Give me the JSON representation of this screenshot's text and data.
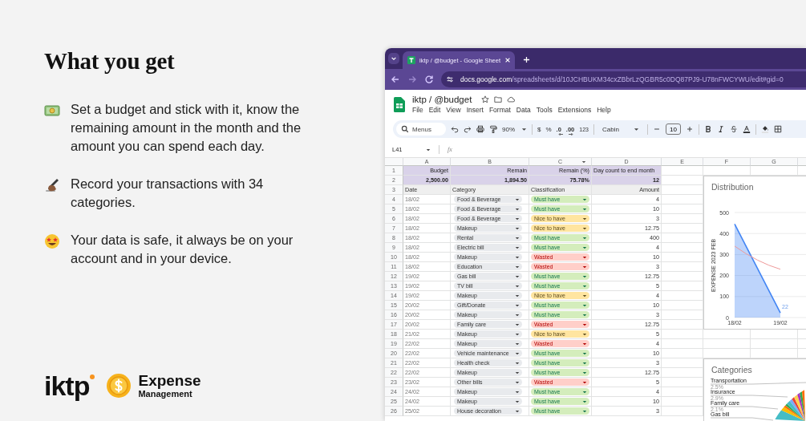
{
  "intro": {
    "title": "What you get",
    "points": [
      {
        "kind": "money",
        "text": "Set a budget and stick with it, know the remaining amount in the month and the amount you can spend each day."
      },
      {
        "kind": "writing",
        "text": "Record your transactions with 34 categories."
      },
      {
        "kind": "star_eyes",
        "text": "Your data is safe, it always be on your account and in your device."
      }
    ]
  },
  "brand": {
    "logo": "iktp",
    "product_name": "Expense",
    "product_subtitle": "Management"
  },
  "browser": {
    "tab_title": "iktp / @budget - Google Sheet",
    "url_host": "docs.google.com",
    "url_path": "/spreadsheets/d/10JCHBUKM34cxZBbrLzQGBR5c0DQ87PJ9-U78nFWCYWU/edit#gid=0"
  },
  "sheet": {
    "title": "iktp / @budget",
    "menu": [
      "File",
      "Edit",
      "View",
      "Insert",
      "Format",
      "Data",
      "Tools",
      "Extensions",
      "Help"
    ],
    "toolbar": {
      "search_placeholder": "Menus",
      "zoom": "90%",
      "currency": "$",
      "percent": "%",
      "decrease_decimals": ".0",
      "increase_decimals": ".00",
      "number_format": "123",
      "font": "Cabin",
      "font_size": "10"
    },
    "cell_ref": "L41",
    "formula_label": "fx",
    "columns": [
      "A",
      "B",
      "C",
      "D",
      "E",
      "F",
      "G"
    ],
    "row_numbers": [
      "1",
      "2",
      "3",
      "4",
      "5",
      "6",
      "7",
      "8",
      "9",
      "10",
      "11",
      "12",
      "13",
      "14",
      "15",
      "16",
      "17",
      "18",
      "19",
      "20",
      "21",
      "22",
      "23",
      "24",
      "25",
      "26"
    ],
    "summary": [
      {
        "label": "Budget",
        "value": "2,500.00"
      },
      {
        "label": "Remain",
        "value": "1,894.50"
      },
      {
        "label": "Remain (%)",
        "value": "75.78%"
      },
      {
        "label": "Day count to end month",
        "value": "12"
      }
    ],
    "header": [
      "Date",
      "Category",
      "Classification",
      "Amount"
    ],
    "rows": [
      {
        "date": "18/02",
        "category": "Food & Beverage",
        "classification": "Must have",
        "kind": "must_have",
        "amount": "4"
      },
      {
        "date": "18/02",
        "category": "Food & Beverage",
        "classification": "Must have",
        "kind": "must_have",
        "amount": "10"
      },
      {
        "date": "18/02",
        "category": "Food & Beverage",
        "classification": "Nice to have",
        "kind": "nice_to_have",
        "amount": "3"
      },
      {
        "date": "18/02",
        "category": "Makeup",
        "classification": "Nice to have",
        "kind": "nice_to_have",
        "amount": "12.75"
      },
      {
        "date": "18/02",
        "category": "Rental",
        "classification": "Must have",
        "kind": "must_have",
        "amount": "400"
      },
      {
        "date": "18/02",
        "category": "Electric bill",
        "classification": "Must have",
        "kind": "must_have",
        "amount": "4"
      },
      {
        "date": "18/02",
        "category": "Makeup",
        "classification": "Wasted",
        "kind": "wasted",
        "amount": "10"
      },
      {
        "date": "18/02",
        "category": "Education",
        "classification": "Wasted",
        "kind": "wasted",
        "amount": "3"
      },
      {
        "date": "19/02",
        "category": "Gas bill",
        "classification": "Must have",
        "kind": "must_have",
        "amount": "12.75"
      },
      {
        "date": "19/02",
        "category": "TV bill",
        "classification": "Must have",
        "kind": "must_have",
        "amount": "5"
      },
      {
        "date": "19/02",
        "category": "Makeup",
        "classification": "Nice to have",
        "kind": "nice_to_have",
        "amount": "4"
      },
      {
        "date": "20/02",
        "category": "Gift/Donate",
        "classification": "Must have",
        "kind": "must_have",
        "amount": "10"
      },
      {
        "date": "20/02",
        "category": "Makeup",
        "classification": "Must have",
        "kind": "must_have",
        "amount": "3"
      },
      {
        "date": "20/02",
        "category": "Family care",
        "classification": "Wasted",
        "kind": "wasted",
        "amount": "12.75"
      },
      {
        "date": "21/02",
        "category": "Makeup",
        "classification": "Nice to have",
        "kind": "nice_to_have",
        "amount": "5"
      },
      {
        "date": "22/02",
        "category": "Makeup",
        "classification": "Wasted",
        "kind": "wasted",
        "amount": "4"
      },
      {
        "date": "22/02",
        "category": "Vehicle maintenance",
        "classification": "Must have",
        "kind": "must_have",
        "amount": "10"
      },
      {
        "date": "22/02",
        "category": "Health check",
        "classification": "Must have",
        "kind": "must_have",
        "amount": "3"
      },
      {
        "date": "22/02",
        "category": "Makeup",
        "classification": "Must have",
        "kind": "must_have",
        "amount": "12.75"
      },
      {
        "date": "23/02",
        "category": "Other bills",
        "classification": "Wasted",
        "kind": "wasted",
        "amount": "5"
      },
      {
        "date": "24/02",
        "category": "Makeup",
        "classification": "Must have",
        "kind": "must_have",
        "amount": "4"
      },
      {
        "date": "24/02",
        "category": "Makeup",
        "classification": "Must have",
        "kind": "must_have",
        "amount": "10"
      },
      {
        "date": "25/02",
        "category": "House decoration",
        "classification": "Must have",
        "kind": "must_have",
        "amount": "3"
      }
    ],
    "distribution": {
      "title": "Distribution",
      "chart_data": {
        "type": "area",
        "ylabel": "EXPENSE 2023 FEB",
        "categories": [
          "18/02",
          "19/02"
        ],
        "series": [
          {
            "type": "area",
            "color": "#4285f4",
            "values": [
              445,
              22
            ]
          },
          {
            "type": "line",
            "color": "#ef9a9a",
            "values": [
              340,
              230
            ]
          }
        ],
        "grid": true,
        "ylim": [
          0,
          500
        ],
        "yticks": [
          0,
          100,
          200,
          300,
          400,
          500
        ],
        "annotations": [
          {
            "x": "19/02",
            "text": "22"
          }
        ]
      }
    },
    "categories": {
      "title": "Categories",
      "labels": [
        {
          "name": "Transportation",
          "percent": "2.5%"
        },
        {
          "name": "Insurance",
          "percent": "2.9%"
        },
        {
          "name": "Family care",
          "percent": "2.1%"
        },
        {
          "name": "Gas bill"
        }
      ]
    }
  }
}
